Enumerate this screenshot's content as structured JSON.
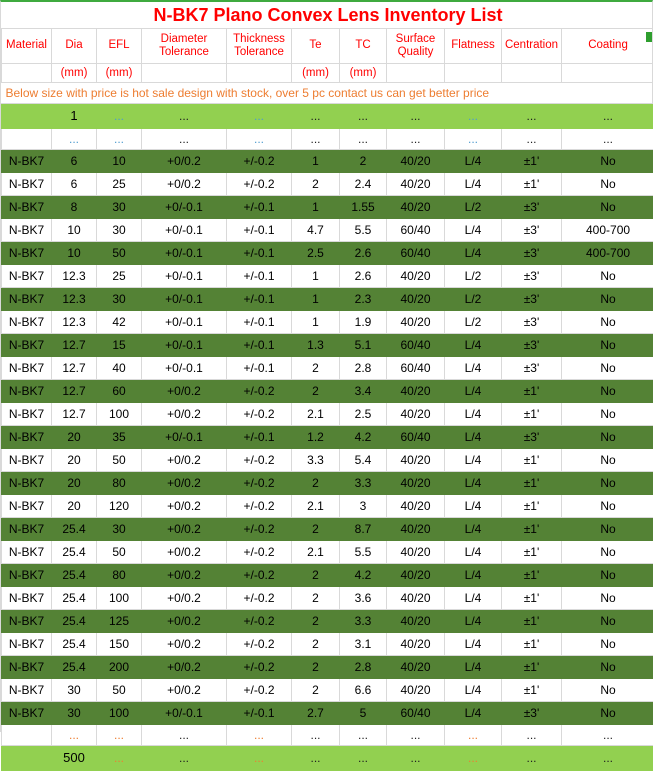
{
  "document": {
    "title": "N-BK7 Plano Convex Lens Inventory List",
    "notice": "Below size with price is hot sale design with stock, over 5 pc contact us can get better price"
  },
  "colors": {
    "title_red": "#ff0000",
    "header_red": "#ff0000",
    "notice_orange": "#ed7d31",
    "row_dark_green": "#548235",
    "row_light_green": "#92d050",
    "grid_line": "#d9d9d9",
    "top_rule_green": "#3faa3f"
  },
  "table": {
    "headers": [
      "Material",
      "Dia",
      "EFL",
      "Diameter Tolerance",
      "Thickness Tolerance",
      "Te",
      "TC",
      "Surface Quality",
      "Flatness",
      "Centration",
      "Coating"
    ],
    "header_lines": [
      [
        "Material"
      ],
      [
        "Dia"
      ],
      [
        "EFL"
      ],
      [
        "Diameter",
        "Tolerance"
      ],
      [
        "Thickness",
        "Tolerance"
      ],
      [
        "Te"
      ],
      [
        "TC"
      ],
      [
        "Surface",
        "Quality"
      ],
      [
        "Flatness"
      ],
      [
        "Centration"
      ],
      [
        "Coating"
      ]
    ],
    "units": [
      "",
      "(mm)",
      "(mm)",
      "",
      "",
      "(mm)",
      "(mm)",
      "",
      "",
      "",
      ""
    ],
    "ellipsis": "...",
    "top_summary_row": {
      "style": "light-green",
      "cells": [
        "",
        "1",
        "...",
        "...",
        "...",
        "...",
        "...",
        "...",
        "...",
        "...",
        "..."
      ]
    },
    "top_dots_row": {
      "style": "white",
      "cells": [
        "",
        "...",
        "...",
        "...",
        "...",
        "...",
        "...",
        "...",
        "...",
        "...",
        "..."
      ]
    },
    "bottom_dots_row": {
      "style": "white",
      "cells": [
        "",
        "...",
        "...",
        "...",
        "...",
        "...",
        "...",
        "...",
        "...",
        "...",
        "..."
      ]
    },
    "bottom_summary_row": {
      "style": "light-green",
      "cells": [
        "",
        "500",
        "...",
        "...",
        "...",
        "...",
        "...",
        "...",
        "...",
        "...",
        "..."
      ]
    },
    "rows": [
      {
        "style": "green",
        "cells": [
          "N-BK7",
          "6",
          "10",
          "+0/0.2",
          "+/-0.2",
          "1",
          "2",
          "40/20",
          "L/4",
          "±1'",
          "No"
        ]
      },
      {
        "style": "white",
        "cells": [
          "N-BK7",
          "6",
          "25",
          "+0/0.2",
          "+/-0.2",
          "2",
          "2.4",
          "40/20",
          "L/4",
          "±1'",
          "No"
        ]
      },
      {
        "style": "green",
        "cells": [
          "N-BK7",
          "8",
          "30",
          "+0/-0.1",
          "+/-0.1",
          "1",
          "1.55",
          "40/20",
          "L/2",
          "±3'",
          "No"
        ]
      },
      {
        "style": "white",
        "cells": [
          "N-BK7",
          "10",
          "30",
          "+0/-0.1",
          "+/-0.1",
          "4.7",
          "5.5",
          "60/40",
          "L/4",
          "±3'",
          "400-700"
        ]
      },
      {
        "style": "green",
        "cells": [
          "N-BK7",
          "10",
          "50",
          "+0/-0.1",
          "+/-0.1",
          "2.5",
          "2.6",
          "60/40",
          "L/4",
          "±3'",
          "400-700"
        ]
      },
      {
        "style": "white",
        "cells": [
          "N-BK7",
          "12.3",
          "25",
          "+0/-0.1",
          "+/-0.1",
          "1",
          "2.6",
          "40/20",
          "L/2",
          "±3'",
          "No"
        ]
      },
      {
        "style": "green",
        "cells": [
          "N-BK7",
          "12.3",
          "30",
          "+0/-0.1",
          "+/-0.1",
          "1",
          "2.3",
          "40/20",
          "L/2",
          "±3'",
          "No"
        ]
      },
      {
        "style": "white",
        "cells": [
          "N-BK7",
          "12.3",
          "42",
          "+0/-0.1",
          "+/-0.1",
          "1",
          "1.9",
          "40/20",
          "L/2",
          "±3'",
          "No"
        ]
      },
      {
        "style": "green",
        "cells": [
          "N-BK7",
          "12.7",
          "15",
          "+0/-0.1",
          "+/-0.1",
          "1.3",
          "5.1",
          "60/40",
          "L/4",
          "±3'",
          "No"
        ]
      },
      {
        "style": "white",
        "cells": [
          "N-BK7",
          "12.7",
          "40",
          "+0/-0.1",
          "+/-0.1",
          "2",
          "2.8",
          "60/40",
          "L/4",
          "±3'",
          "No"
        ]
      },
      {
        "style": "green",
        "cells": [
          "N-BK7",
          "12.7",
          "60",
          "+0/0.2",
          "+/-0.2",
          "2",
          "3.4",
          "40/20",
          "L/4",
          "±1'",
          "No"
        ]
      },
      {
        "style": "white",
        "cells": [
          "N-BK7",
          "12.7",
          "100",
          "+0/0.2",
          "+/-0.2",
          "2.1",
          "2.5",
          "40/20",
          "L/4",
          "±1'",
          "No"
        ]
      },
      {
        "style": "green",
        "cells": [
          "N-BK7",
          "20",
          "35",
          "+0/-0.1",
          "+/-0.1",
          "1.2",
          "4.2",
          "60/40",
          "L/4",
          "±3'",
          "No"
        ]
      },
      {
        "style": "white",
        "cells": [
          "N-BK7",
          "20",
          "50",
          "+0/0.2",
          "+/-0.2",
          "3.3",
          "5.4",
          "40/20",
          "L/4",
          "±1'",
          "No"
        ]
      },
      {
        "style": "green",
        "cells": [
          "N-BK7",
          "20",
          "80",
          "+0/0.2",
          "+/-0.2",
          "2",
          "3.3",
          "40/20",
          "L/4",
          "±1'",
          "No"
        ]
      },
      {
        "style": "white",
        "cells": [
          "N-BK7",
          "20",
          "120",
          "+0/0.2",
          "+/-0.2",
          "2.1",
          "3",
          "40/20",
          "L/4",
          "±1'",
          "No"
        ]
      },
      {
        "style": "green",
        "cells": [
          "N-BK7",
          "25.4",
          "30",
          "+0/0.2",
          "+/-0.2",
          "2",
          "8.7",
          "40/20",
          "L/4",
          "±1'",
          "No"
        ]
      },
      {
        "style": "white",
        "cells": [
          "N-BK7",
          "25.4",
          "50",
          "+0/0.2",
          "+/-0.2",
          "2.1",
          "5.5",
          "40/20",
          "L/4",
          "±1'",
          "No"
        ]
      },
      {
        "style": "green",
        "cells": [
          "N-BK7",
          "25.4",
          "80",
          "+0/0.2",
          "+/-0.2",
          "2",
          "4.2",
          "40/20",
          "L/4",
          "±1'",
          "No"
        ]
      },
      {
        "style": "white",
        "cells": [
          "N-BK7",
          "25.4",
          "100",
          "+0/0.2",
          "+/-0.2",
          "2",
          "3.6",
          "40/20",
          "L/4",
          "±1'",
          "No"
        ]
      },
      {
        "style": "green",
        "cells": [
          "N-BK7",
          "25.4",
          "125",
          "+0/0.2",
          "+/-0.2",
          "2",
          "3.3",
          "40/20",
          "L/4",
          "±1'",
          "No"
        ]
      },
      {
        "style": "white",
        "cells": [
          "N-BK7",
          "25.4",
          "150",
          "+0/0.2",
          "+/-0.2",
          "2",
          "3.1",
          "40/20",
          "L/4",
          "±1'",
          "No"
        ]
      },
      {
        "style": "green",
        "cells": [
          "N-BK7",
          "25.4",
          "200",
          "+0/0.2",
          "+/-0.2",
          "2",
          "2.8",
          "40/20",
          "L/4",
          "±1'",
          "No"
        ]
      },
      {
        "style": "white",
        "cells": [
          "N-BK7",
          "30",
          "50",
          "+0/0.2",
          "+/-0.2",
          "2",
          "6.6",
          "40/20",
          "L/4",
          "±1'",
          "No"
        ]
      },
      {
        "style": "green",
        "cells": [
          "N-BK7",
          "30",
          "100",
          "+0/-0.1",
          "+/-0.1",
          "2.7",
          "5",
          "60/40",
          "L/4",
          "±3'",
          "No"
        ]
      }
    ]
  }
}
